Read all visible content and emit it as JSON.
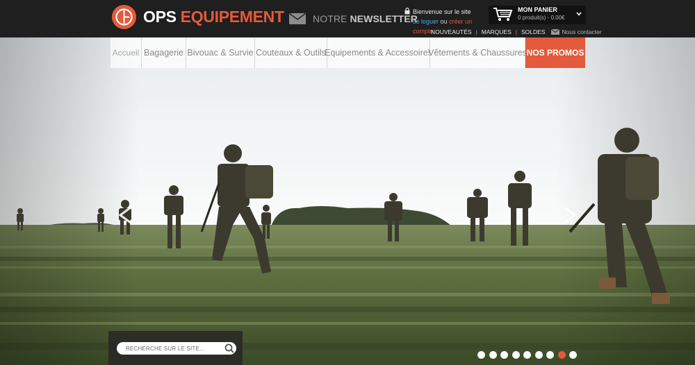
{
  "brand": {
    "name_part1": "OPS",
    "name_part2": "EQUIPEMENT",
    "accent_color": "#e45a3c",
    "logo_icon": "oe-monogram-logo"
  },
  "newsletter": {
    "prefix": "NOTRE",
    "label": "NEWSLETTER",
    "icon": "envelope-icon"
  },
  "account": {
    "welcome": "Bienvenue sur le site",
    "login": "se loguer",
    "or": "ou",
    "create": "créer un compte",
    "icon": "lock-icon"
  },
  "cart": {
    "title": "MON PANIER",
    "info": "0 produit(s) - 0.00€",
    "icon": "shopping-cart-icon"
  },
  "top_links": {
    "items": [
      "NOUVEAUTÉS",
      "MARQUES",
      "SOLDES"
    ],
    "contact": "Nous contacter"
  },
  "nav": {
    "items": [
      "Accueil",
      "Bagagerie",
      "Bivouac & Survie",
      "Couteaux & Outils",
      "Equipements & Accessoires",
      "Vêtements & Chaussures",
      "NOS PROMOS"
    ]
  },
  "search": {
    "placeholder": "RECHERCHE SUR LE SITE..."
  },
  "slider": {
    "slide_count": 9,
    "active_slide_index": 7
  }
}
